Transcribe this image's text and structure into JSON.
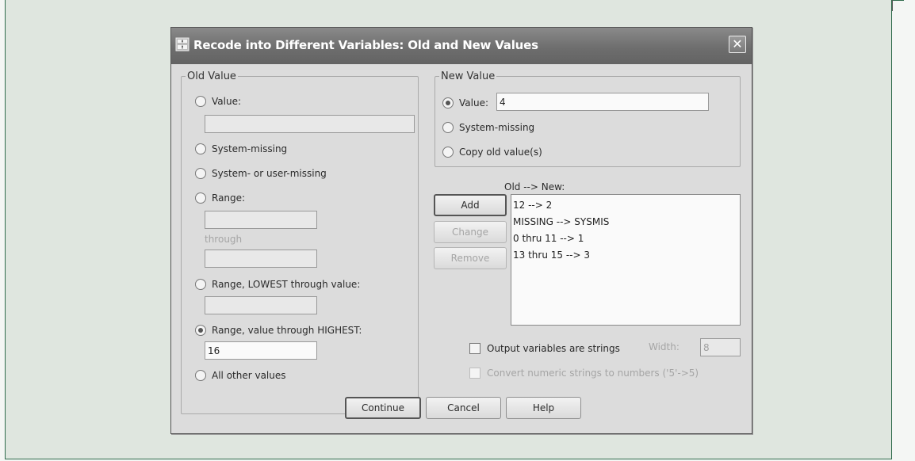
{
  "dialog": {
    "title": "Recode into Different Variables: Old and New Values",
    "close_glyph": "✕"
  },
  "old_value": {
    "legend": "Old Value",
    "value_label": "Value:",
    "value_input": "",
    "system_missing_label": "System-missing",
    "system_user_missing_label": "System- or user-missing",
    "range_label": "Range:",
    "range_from": "",
    "through_label": "through",
    "range_to": "",
    "range_lowest_label": "Range, LOWEST through value:",
    "range_lowest_input": "",
    "range_highest_label": "Range, value through HIGHEST:",
    "range_highest_input": "16",
    "all_other_label": "All other values",
    "selected": "range_highest"
  },
  "new_value": {
    "legend": "New Value",
    "value_label": "Value:",
    "value_input": "4",
    "system_missing_label": "System-missing",
    "copy_old_label": "Copy old value(s)",
    "selected": "value"
  },
  "mapping": {
    "label": "Old --> New:",
    "items": [
      "12 --> 2",
      "MISSING --> SYSMIS",
      "0 thru 11 --> 1",
      "13 thru 15 --> 3"
    ],
    "add_label": "Add",
    "change_label": "Change",
    "remove_label": "Remove"
  },
  "options": {
    "output_strings_label": "Output variables are strings",
    "output_strings_checked": false,
    "width_label": "Width:",
    "width_value": "8",
    "convert_label": "Convert numeric strings to numbers ('5'->5)",
    "convert_checked": false
  },
  "footer": {
    "continue_label": "Continue",
    "cancel_label": "Cancel",
    "help_label": "Help"
  },
  "colors": {
    "brand_green": "#1d6a3e",
    "titlebar": "#6e6e6e",
    "dialog_bg": "#dcdcdc"
  }
}
